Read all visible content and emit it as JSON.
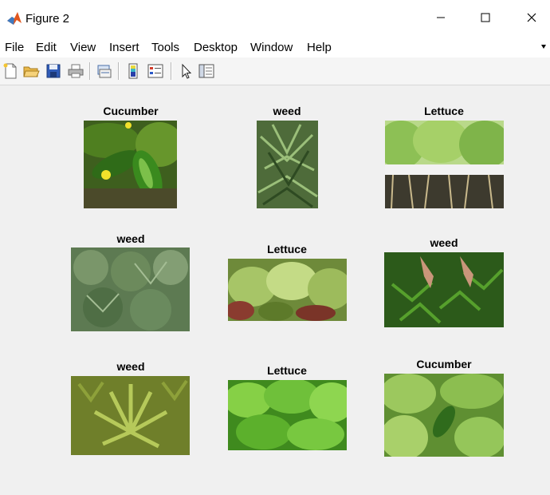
{
  "window": {
    "title": "Figure 2"
  },
  "menu": [
    "File",
    "Edit",
    "View",
    "Insert",
    "Tools",
    "Desktop",
    "Window",
    "Help"
  ],
  "toolbar": {
    "icons": [
      "new-figure-icon",
      "open-file-icon",
      "save-icon",
      "print-icon",
      "link-figure-icon",
      "colorbar-icon",
      "legend-icon",
      "select-arrow-icon",
      "property-editor-icon"
    ]
  },
  "subplots": [
    {
      "title": "Cucumber"
    },
    {
      "title": "weed"
    },
    {
      "title": "Lettuce"
    },
    {
      "title": "weed"
    },
    {
      "title": "Lettuce"
    },
    {
      "title": "weed"
    },
    {
      "title": "weed"
    },
    {
      "title": "Lettuce"
    },
    {
      "title": "Cucumber"
    }
  ]
}
